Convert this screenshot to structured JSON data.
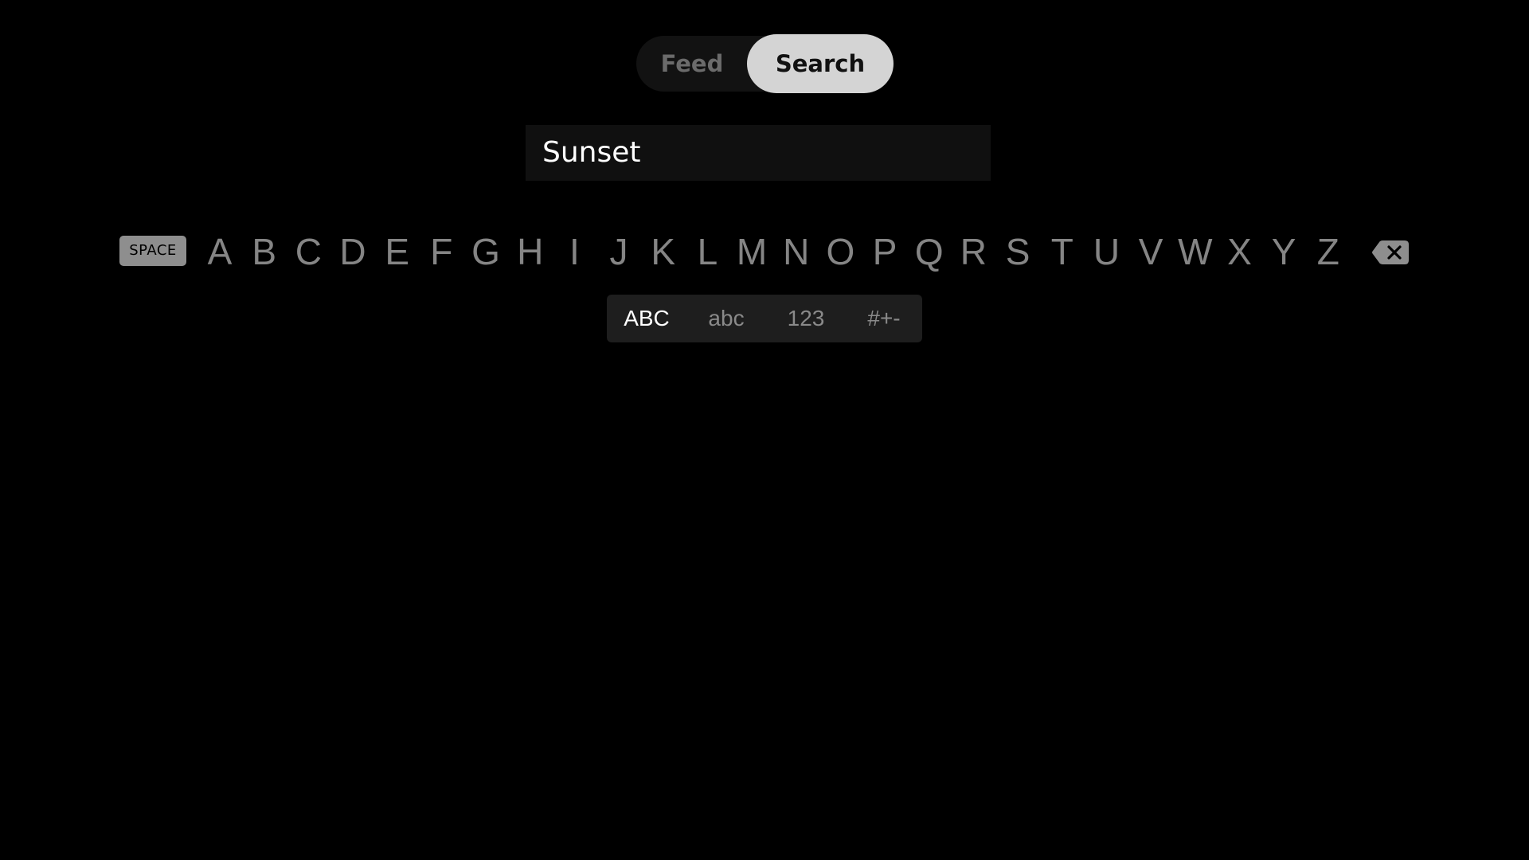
{
  "tabs": {
    "feed_label": "Feed",
    "search_label": "Search",
    "selected": "Search"
  },
  "search": {
    "value": "Sunset"
  },
  "keyboard": {
    "space_label": "SPACE",
    "letters": [
      "A",
      "B",
      "C",
      "D",
      "E",
      "F",
      "G",
      "H",
      "I",
      "J",
      "K",
      "L",
      "M",
      "N",
      "O",
      "P",
      "Q",
      "R",
      "S",
      "T",
      "U",
      "V",
      "W",
      "X",
      "Y",
      "Z"
    ],
    "backspace_icon": "backspace-icon",
    "modes": [
      "ABC",
      "abc",
      "123",
      "#+-"
    ],
    "active_mode": "ABC"
  },
  "colors": {
    "background": "#000000",
    "selected_tab": "#d4d4d4",
    "key_text": "#858585",
    "active_mode_text": "#ffffff"
  }
}
